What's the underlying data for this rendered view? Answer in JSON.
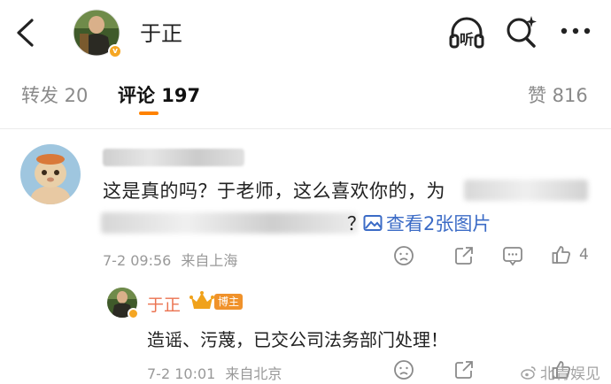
{
  "header": {
    "title": "于正",
    "back_icon": "chevron-left-icon",
    "listen_label": "听",
    "search_icon": "search-sparkle-icon",
    "more_icon": "more-dots-icon"
  },
  "tabs": {
    "reposts": "转发 20",
    "comments": "评论 197",
    "likes": "赞 816"
  },
  "comment": {
    "text_line1": "这是真的吗？于老师，这么喜欢你的，为",
    "text_line2_visible": "？",
    "view_pictures": "查看2张图片",
    "time": "7-2 09:56",
    "location": "来自上海",
    "like_count": "4"
  },
  "reply": {
    "author": "于正",
    "badge": "博主",
    "text": "造谣、污蔑，已交公司法务部门处理！",
    "time": "7-2 10:01",
    "location": "来自北京"
  },
  "watermark": "北青娱见",
  "colors": {
    "accent": "#ff8200",
    "link": "#3b6bc6",
    "author_name": "#eb7350",
    "verified": "#f5a623"
  }
}
